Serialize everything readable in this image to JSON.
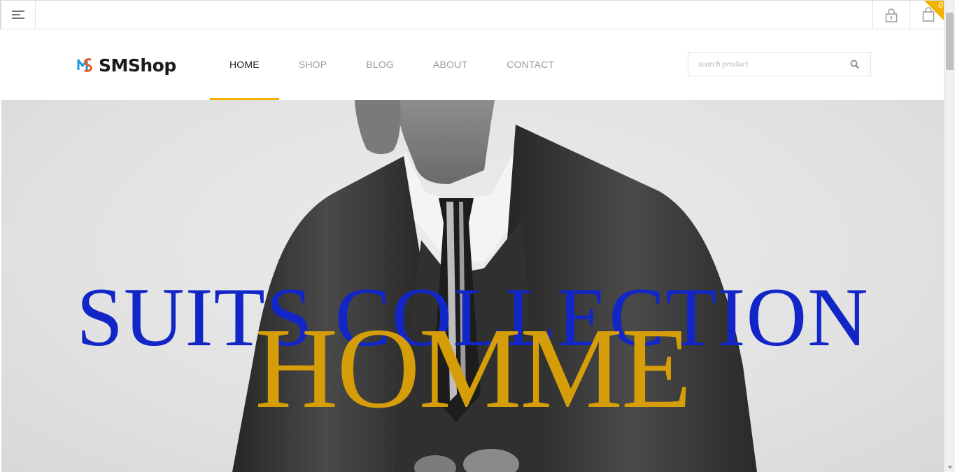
{
  "topbar": {
    "menu_icon": "hamburger-menu-icon",
    "account_icon": "lock-icon",
    "cart_icon": "shopping-bag-icon",
    "cart_count": "0",
    "accent_color": "#f0b400"
  },
  "header": {
    "logo_text": "SMShop",
    "nav": [
      {
        "label": "HOME",
        "active": true
      },
      {
        "label": "SHOP",
        "active": false
      },
      {
        "label": "BLOG",
        "active": false
      },
      {
        "label": "ABOUT",
        "active": false
      },
      {
        "label": "CONTACT",
        "active": false
      }
    ],
    "search": {
      "placeholder": "search product",
      "value": "",
      "icon": "search-icon"
    }
  },
  "hero": {
    "line1": "SUITS COLLECTION",
    "line2": "HOMME",
    "line1_color": "#1226c8",
    "line2_color": "#d59d07"
  }
}
